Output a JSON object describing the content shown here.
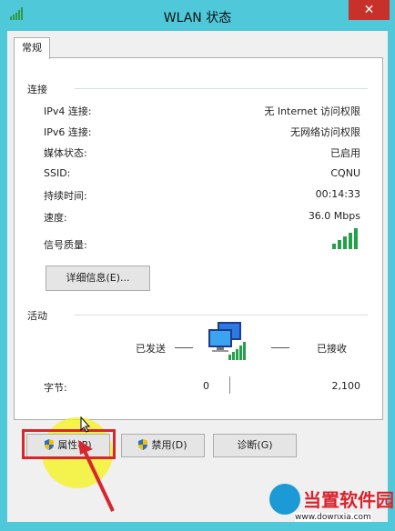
{
  "window": {
    "title": "WLAN 状态",
    "close_glyph": "✕"
  },
  "tabs": [
    {
      "label": "常规"
    }
  ],
  "connection": {
    "section_label": "连接",
    "rows": [
      {
        "label": "IPv4 连接:",
        "value": "无 Internet 访问权限"
      },
      {
        "label": "IPv6 连接:",
        "value": "无网络访问权限"
      },
      {
        "label": "媒体状态:",
        "value": "已启用"
      },
      {
        "label": "SSID:",
        "value": "CQNU"
      },
      {
        "label": "持续时间:",
        "value": "00:14:33"
      },
      {
        "label": "速度:",
        "value": "36.0 Mbps"
      }
    ],
    "signal_label": "信号质量:",
    "signal_level": 5,
    "signal_max": 5,
    "details_button": "详细信息(E)..."
  },
  "activity": {
    "section_label": "活动",
    "sent_label": "已发送",
    "received_label": "已接收",
    "bytes_label": "字节:",
    "bytes_sent": "0",
    "bytes_received": "2,100"
  },
  "buttons": {
    "properties": "属性(P)",
    "disable": "禁用(D)",
    "diagnose": "诊断(G)"
  },
  "icons": {
    "app": "wifi-signal-icon",
    "close": "close-icon",
    "shield": "uac-shield-icon",
    "network": "network-computer-icon"
  },
  "colors": {
    "frame": "#4fc8d9",
    "close": "#c8312a",
    "signal": "#23a04a",
    "annotation_red": "#d7262d",
    "annotation_yellow": "#f5f21e"
  },
  "watermark": {
    "brand": "当置软件园",
    "site": "www.downxia.com"
  }
}
